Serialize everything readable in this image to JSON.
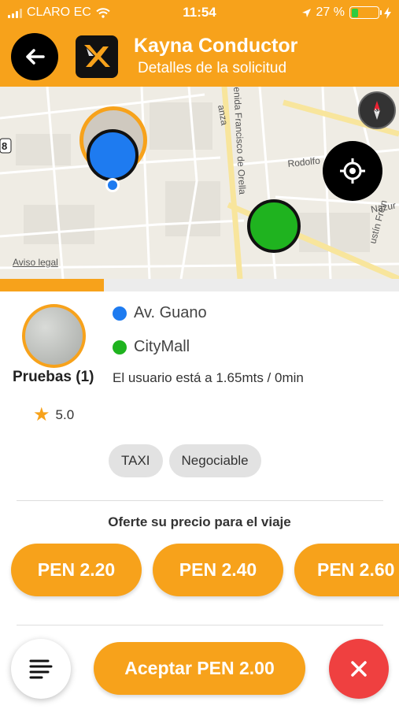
{
  "status_bar": {
    "carrier": "CLARO EC",
    "time": "11:54",
    "battery_percent": "27 %",
    "battery_level": 0.27
  },
  "header": {
    "title": "Kayna Conductor",
    "subtitle": "Detalles de la solicitud",
    "logo_text": "KAYNA"
  },
  "map": {
    "street_labels": [
      "enida Francisco de Orella",
      "Rodolfo",
      "Nazur",
      "anza",
      "ustín Frein"
    ],
    "legal_link": "Aviso legal",
    "road_badge": "8"
  },
  "request_progress": 0.26,
  "passenger": {
    "name": "Pruebas (1)",
    "rating": "5.0"
  },
  "trip": {
    "origin": "Av. Guano",
    "destination": "CityMall",
    "distance_text": "El usuario está a 1.65mts / 0min"
  },
  "tags": [
    "TAXI",
    "Negociable"
  ],
  "offer": {
    "title": "Oferte su precio para el viaje",
    "prices": [
      "PEN 2.20",
      "PEN 2.40",
      "PEN 2.60"
    ]
  },
  "actions": {
    "accept_label": "Aceptar PEN 2.00"
  },
  "colors": {
    "brand": "#f7a21b",
    "origin": "#1e7bf0",
    "destination": "#1fb31f",
    "cancel": "#ef4040"
  }
}
